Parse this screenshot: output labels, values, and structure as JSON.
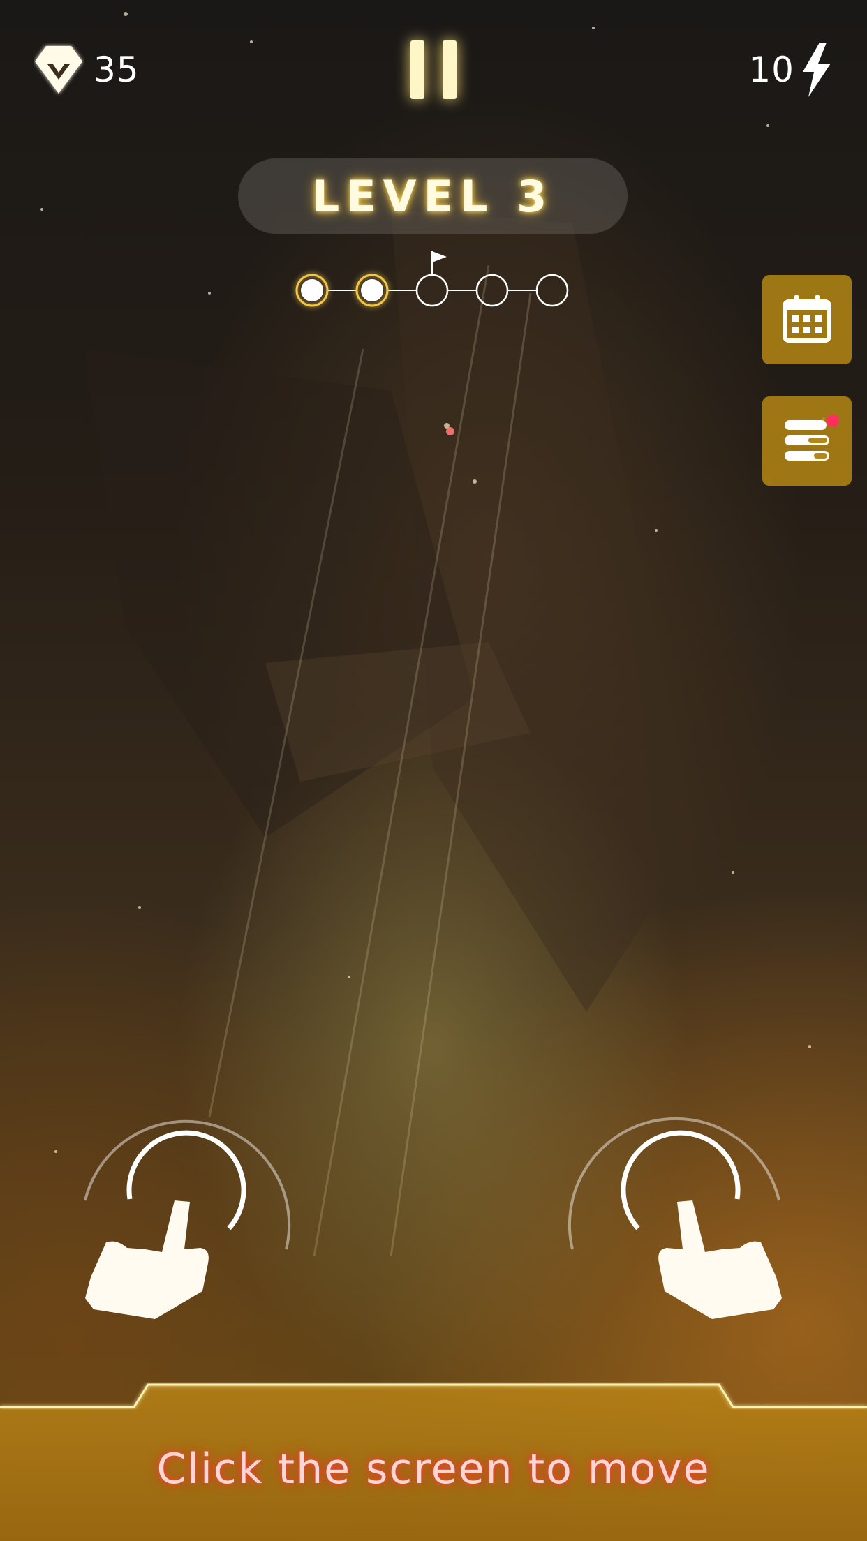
{
  "hud": {
    "gems": "35",
    "energy": "10",
    "gem_icon": "diamond-icon",
    "energy_icon": "lightning-bolt-icon",
    "pause_icon": "pause-icon"
  },
  "level": {
    "title": "LEVEL 3",
    "progress_nodes_total": 5,
    "progress_nodes_completed": 2,
    "flag_node_index": 2
  },
  "side_buttons": [
    {
      "icon": "calendar-icon",
      "has_notification": false
    },
    {
      "icon": "task-list-icon",
      "has_notification": true
    }
  ],
  "tutorial": {
    "hint": "Click the screen to move",
    "left_icon": "hand-tap-left-icon",
    "right_icon": "hand-tap-right-icon"
  },
  "colors": {
    "accent_gold": "#f2c64a",
    "button_bg": "#b4871a",
    "hint_glow": "#ff3c3c",
    "notification": "#ff3060"
  }
}
